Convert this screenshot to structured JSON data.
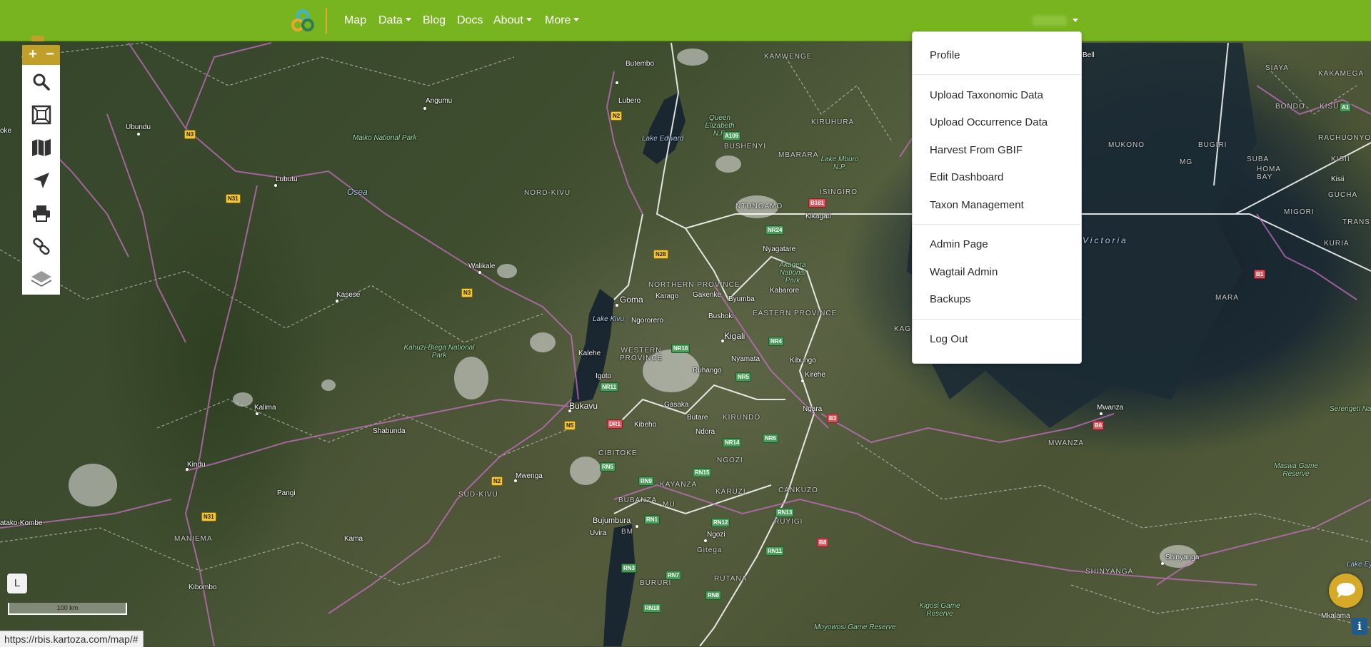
{
  "navbar": {
    "items": [
      {
        "label": "Map"
      },
      {
        "label": "Data"
      },
      {
        "label": "Blog"
      },
      {
        "label": "Docs"
      },
      {
        "label": "About"
      },
      {
        "label": "More"
      }
    ],
    "logo_icon": "kartoza-logo-icon",
    "colors": {
      "navbar": "#77b41f",
      "accent": "#e8a92a"
    }
  },
  "user_menu": {
    "items": [
      {
        "label": "Profile"
      },
      {
        "label": "Upload Taxonomic Data"
      },
      {
        "label": "Upload Occurrence Data"
      },
      {
        "label": "Harvest From GBIF"
      },
      {
        "label": "Edit Dashboard"
      },
      {
        "label": "Taxon Management"
      },
      {
        "label": "Admin Page"
      },
      {
        "label": "Wagtail Admin"
      },
      {
        "label": "Backups"
      },
      {
        "label": "Log Out"
      }
    ]
  },
  "map_tools": {
    "zoom_in": "+",
    "zoom_out": "−",
    "icons": [
      "search-icon",
      "zoom-extent-icon",
      "map-icon",
      "locate-icon",
      "print-icon",
      "link-icon",
      "layers-icon"
    ]
  },
  "map": {
    "places": [
      {
        "text": "Butembo"
      },
      {
        "text": "Lubero"
      },
      {
        "text": "Angumu"
      },
      {
        "text": "Ubundu"
      },
      {
        "text": "Maiko National Park"
      },
      {
        "text": "Lake Edward"
      },
      {
        "text": "Queen Elizabeth N.P."
      },
      {
        "text": "Lubutu"
      },
      {
        "text": "Osea"
      },
      {
        "text": "NORD-KIVU"
      },
      {
        "text": "Walikale"
      },
      {
        "text": "Kasese"
      },
      {
        "text": "Goma"
      },
      {
        "text": "Karago"
      },
      {
        "text": "Gakenke"
      },
      {
        "text": "Byumba"
      },
      {
        "text": "Bushoki"
      },
      {
        "text": "Ngororero"
      },
      {
        "text": "Kigali"
      },
      {
        "text": "Nyamata"
      },
      {
        "text": "Kibungo"
      },
      {
        "text": "Kirehe"
      },
      {
        "text": "Ruhango"
      },
      {
        "text": "Kalehe"
      },
      {
        "text": "Kahuzi-Biega National Park"
      },
      {
        "text": "Bukavu"
      },
      {
        "text": "Kalima"
      },
      {
        "text": "Shabunda"
      },
      {
        "text": "Gasaka"
      },
      {
        "text": "Butare"
      },
      {
        "text": "Kibeho"
      },
      {
        "text": "Ndora"
      },
      {
        "text": "Ngara"
      },
      {
        "text": "Kindu"
      },
      {
        "text": "Mwenga"
      },
      {
        "text": "SUD-KIVU"
      },
      {
        "text": "Pangi"
      },
      {
        "text": "Bujumbura"
      },
      {
        "text": "Uvira"
      },
      {
        "text": "Ngozi"
      },
      {
        "text": "Gitega"
      },
      {
        "text": "MANIEMA"
      },
      {
        "text": "Kama"
      },
      {
        "text": "Kibombo"
      },
      {
        "text": "atako-Kombe"
      },
      {
        "text": "Mwanza"
      },
      {
        "text": "MWANZA"
      },
      {
        "text": "Shinyanga"
      },
      {
        "text": "SHINYANGA"
      },
      {
        "text": "MUKONO"
      },
      {
        "text": "BUGIRI"
      },
      {
        "text": "Victoria"
      },
      {
        "text": "MARA"
      },
      {
        "text": "Kikagati"
      },
      {
        "text": "Nyagatare"
      },
      {
        "text": "Kabarore"
      },
      {
        "text": "NORTHERN PROVINCE"
      },
      {
        "text": "EASTERN PROVINCE"
      },
      {
        "text": "WESTERN PROVINCE"
      },
      {
        "text": "Kigosi Game Reserve"
      },
      {
        "text": "Moyowosi Game Reserve"
      },
      {
        "text": "Maswa Game Reserve"
      },
      {
        "text": "Serengeti National"
      },
      {
        "text": "KISUMU"
      },
      {
        "text": "BONDO"
      },
      {
        "text": "HOMA BAY"
      },
      {
        "text": "MIGORI"
      },
      {
        "text": "KURIA"
      },
      {
        "text": "Mkalama"
      },
      {
        "text": "Akagera National Park"
      },
      {
        "text": "Lake Kivu"
      },
      {
        "text": "Bell"
      },
      {
        "text": "KAKAMEGA"
      },
      {
        "text": "SIAYA"
      },
      {
        "text": "Lake Mburo N.P."
      },
      {
        "text": "ISINGIRO"
      },
      {
        "text": "NTUNGAMO"
      },
      {
        "text": "KIRUHURA"
      },
      {
        "text": "BUSHENYI"
      },
      {
        "text": "MBARARA"
      },
      {
        "text": "KAMWENGE"
      },
      {
        "text": "SUBA"
      },
      {
        "text": "GUCHA"
      },
      {
        "text": "RACHUONYO"
      },
      {
        "text": "TRANS MA"
      },
      {
        "text": "KISII"
      },
      {
        "text": "Kisii"
      },
      {
        "text": "MG"
      },
      {
        "text": "Lake Ey"
      },
      {
        "text": "RUTANA"
      },
      {
        "text": "RUYIGI"
      },
      {
        "text": "CANKUZO"
      },
      {
        "text": "KARUZI"
      },
      {
        "text": "KAYANZA"
      },
      {
        "text": "BUBANZA"
      },
      {
        "text": "CIBITOKE"
      },
      {
        "text": "KIRUNDO"
      },
      {
        "text": "BURURI"
      },
      {
        "text": "MU"
      },
      {
        "text": "BM"
      },
      {
        "text": "KAG"
      },
      {
        "text": "oke"
      },
      {
        "text": "Igoto"
      },
      {
        "text": "NGOZI"
      }
    ],
    "shields": [
      {
        "text": "N3"
      },
      {
        "text": "N2"
      },
      {
        "text": "N31"
      },
      {
        "text": "N28"
      },
      {
        "text": "N3"
      },
      {
        "text": "N5"
      },
      {
        "text": "N2"
      },
      {
        "text": "N31"
      },
      {
        "text": "A109"
      },
      {
        "text": "NR24"
      },
      {
        "text": "NR16"
      },
      {
        "text": "NR4"
      },
      {
        "text": "NR5"
      },
      {
        "text": "NR11"
      },
      {
        "text": "NR6"
      },
      {
        "text": "NR14"
      },
      {
        "text": "RN5"
      },
      {
        "text": "RN9"
      },
      {
        "text": "RN15"
      },
      {
        "text": "RN1"
      },
      {
        "text": "RN12"
      },
      {
        "text": "RN13"
      },
      {
        "text": "RN11"
      },
      {
        "text": "RN3"
      },
      {
        "text": "RN7"
      },
      {
        "text": "RN8"
      },
      {
        "text": "RN18"
      },
      {
        "text": "B3"
      },
      {
        "text": "B6"
      },
      {
        "text": "B8"
      },
      {
        "text": "B181"
      },
      {
        "text": "B1"
      },
      {
        "text": "A1"
      },
      {
        "text": "DR1"
      }
    ]
  },
  "legend_button": "L",
  "scale": "100 km",
  "status_url": "https://rbis.kartoza.com/map/#",
  "info_button": "i",
  "chat_icon": "chat-bubble-icon"
}
